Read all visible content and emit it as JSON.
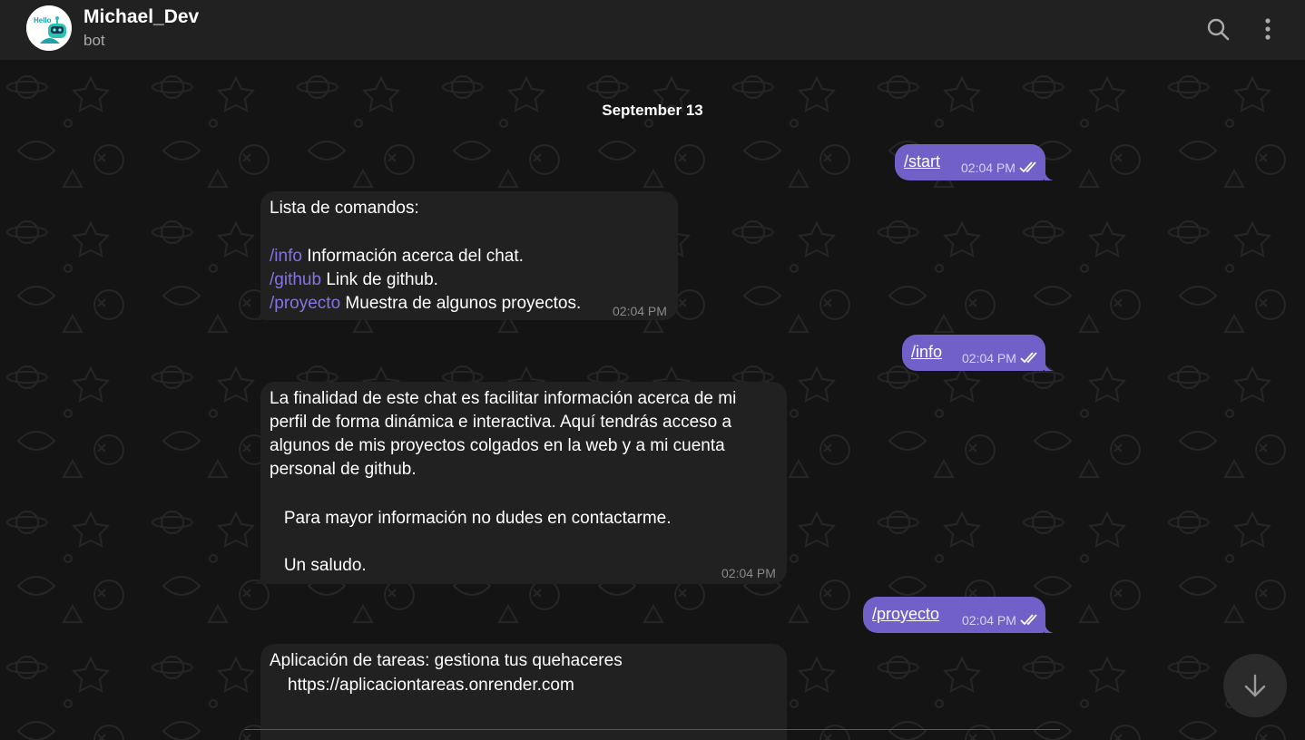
{
  "header": {
    "title": "Michael_Dev",
    "subtitle": "bot",
    "avatar_text": "Hello"
  },
  "chat": {
    "date": "September 13",
    "messages": [
      {
        "direction": "out",
        "text": "/start",
        "time": "02:04 PM",
        "status": "read"
      },
      {
        "direction": "in",
        "time": "02:04 PM",
        "heading": "Lista de comandos:",
        "commands": [
          {
            "cmd": "/info",
            "desc": " Información acerca del chat."
          },
          {
            "cmd": "/github",
            "desc": " Link de github."
          },
          {
            "cmd": "/proyecto",
            "desc": " Muestra de algunos proyectos."
          }
        ]
      },
      {
        "direction": "out",
        "text": "/info",
        "time": "02:04 PM",
        "status": "read"
      },
      {
        "direction": "in",
        "time": "02:04 PM",
        "lines": [
          "La finalidad de este chat es facilitar información acerca de mi",
          "perfil de forma dinámica e interactiva. Aquí tendrás acceso a",
          "algunos de mis proyectos colgados en la web y a mi cuenta",
          "personal de github.",
          "   Para mayor información no dudes en contactarme.",
          "   Un saludo."
        ]
      },
      {
        "direction": "out",
        "text": "/proyecto",
        "time": "02:04 PM",
        "status": "read"
      },
      {
        "direction": "in",
        "lines": [
          "Aplicación de tareas: gestiona tus quehaceres"
        ],
        "url": "https://aplicaciontareas.onrender.com"
      }
    ]
  },
  "colors": {
    "header_bg": "#212121",
    "outgoing_bubble": "#7260c9",
    "incoming_bubble": "#212121",
    "link": "#8774e1"
  },
  "icons": {
    "search": "search-icon",
    "menu": "more-vertical-icon",
    "scroll_down": "arrow-down-icon",
    "read_status": "double-check-icon"
  }
}
